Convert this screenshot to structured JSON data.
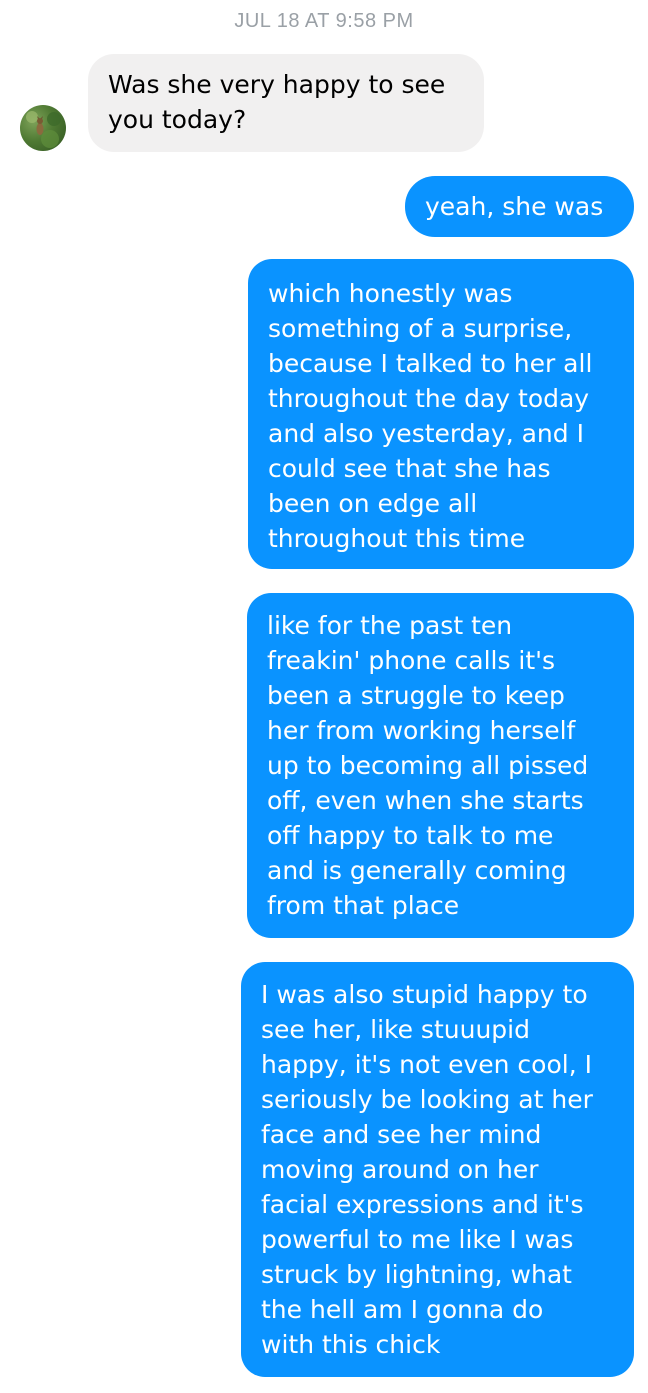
{
  "conversation": {
    "timestamp": "JUL 18 AT 9:58 PM",
    "contact_avatar_icon": "contact-avatar-photo",
    "messages": [
      {
        "direction": "incoming",
        "text": "Was she very happy to see\nyou today?"
      },
      {
        "direction": "outgoing",
        "text": "yeah, she was"
      },
      {
        "direction": "outgoing",
        "text": "which honestly was\nsomething of a surprise,\nbecause I talked to her all\nthroughout the day today\nand also yesterday, and I\ncould see that she has\nbeen on edge all\nthroughout this time"
      },
      {
        "direction": "outgoing",
        "text": "like for the past ten\nfreakin' phone calls it's\nbeen a struggle to keep\nher from working herself\nup to becoming all pissed\noff, even when she starts\noff happy to talk to me\nand is generally coming\nfrom that place"
      },
      {
        "direction": "outgoing",
        "text": "I was also stupid happy to\nsee her, like stuuupid\nhappy, it's not even cool, I\nseriously be looking at her\nface and see her mind\nmoving around on her\nfacial expressions and it's\npowerful to me like I was\nstruck by lightning, what\nthe hell am I gonna do\nwith this chick"
      }
    ]
  },
  "colors": {
    "incoming_bubble": "#f1f0f0",
    "outgoing_bubble": "#0a93ff",
    "timestamp_text": "#9aa0a6"
  }
}
